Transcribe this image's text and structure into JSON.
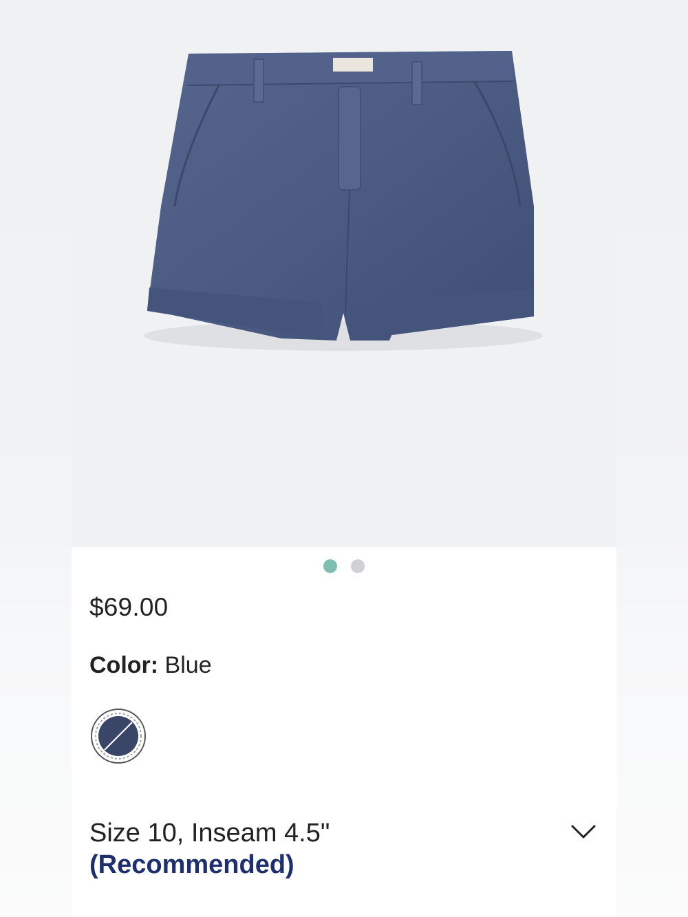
{
  "product": {
    "image_alt": "Blue chino shorts",
    "price": "$69.00",
    "color_label": "Color:",
    "color_value": "Blue",
    "swatch_color": "#3a4668",
    "size_line": "Size 10, Inseam 4.5\"",
    "size_note": "(Recommended)",
    "carousel": {
      "total": 2,
      "active": 0
    }
  },
  "colors": {
    "dot_active": "#7fbfb1",
    "dot_inactive": "#cfd1d4",
    "recommended": "#1f2f6e",
    "shorts": "#4a5a82"
  },
  "icons": {
    "expand": "chevron-down-icon",
    "swatch": "color-swatch-icon"
  }
}
